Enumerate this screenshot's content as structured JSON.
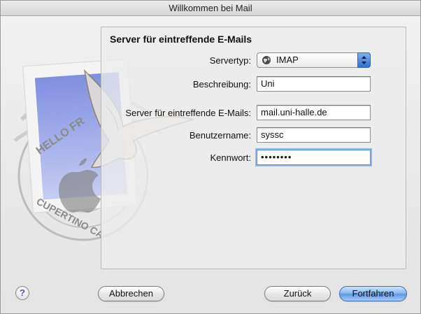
{
  "window": {
    "title": "Willkommen bei Mail"
  },
  "panel": {
    "heading": "Server für eintreffende E-Mails",
    "fields": {
      "servertyp": {
        "label": "Servertyp:",
        "value": "IMAP"
      },
      "beschreibung": {
        "label": "Beschreibung:",
        "value": "Uni"
      },
      "server": {
        "label": "Server für eintreffende E-Mails:",
        "value": "mail.uni-halle.de"
      },
      "benutzername": {
        "label": "Benutzername:",
        "value": "syssc"
      },
      "kennwort": {
        "label": "Kennwort:",
        "value": "••••••••"
      }
    }
  },
  "stamp": {
    "ring_text_top": "HELLO FR",
    "ring_text_bottom": "CUPERTINO CA"
  },
  "buttons": {
    "help": "?",
    "cancel": "Abbrechen",
    "back": "Zurück",
    "continue": "Fortfahren"
  },
  "icons": {
    "servertype": "globe-icon",
    "popup_arrows": "updown-arrows-icon",
    "help": "help-icon"
  }
}
